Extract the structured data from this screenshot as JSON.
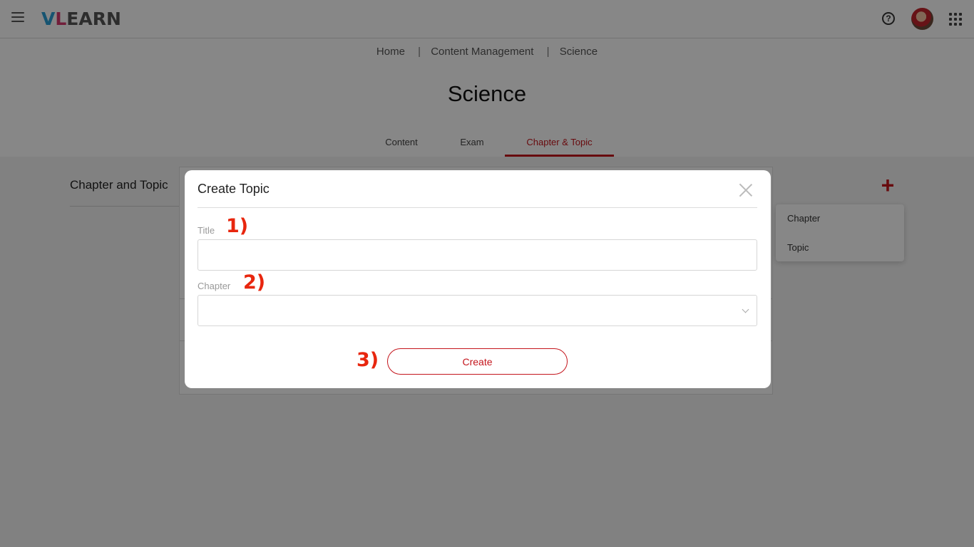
{
  "header": {
    "logo_text": "VLEARN",
    "icons": [
      "menu-icon",
      "help-icon",
      "avatar",
      "apps-grid-icon"
    ],
    "help_glyph": "?"
  },
  "breadcrumb": [
    "Home",
    "Content Management",
    "Science"
  ],
  "page_title": "Science",
  "tabs": [
    {
      "label": "Content",
      "active": false
    },
    {
      "label": "Exam",
      "active": false
    },
    {
      "label": "Chapter & Topic",
      "active": true
    }
  ],
  "section": {
    "title": "Chapter and Topic",
    "add_glyph": "+",
    "menu_items": [
      "Chapter",
      "Topic"
    ]
  },
  "modal": {
    "title": "Create Topic",
    "fields": [
      {
        "label": "Title",
        "value": "",
        "annotation": "1)"
      },
      {
        "label": "Chapter",
        "value": "",
        "annotation": "2)"
      }
    ],
    "submit": {
      "label": "Create",
      "annotation": "3)"
    }
  },
  "colors": {
    "accent": "#c4151c",
    "annotation": "#e8260e",
    "overlay": "rgba(0,0,0,0.47)"
  }
}
